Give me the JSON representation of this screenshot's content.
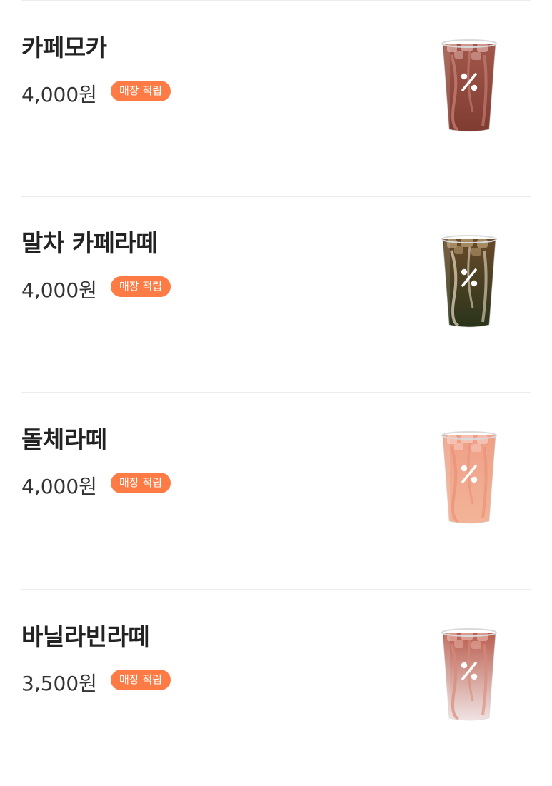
{
  "menu": {
    "items": [
      {
        "name": "카페모카",
        "price": "4,000원",
        "badge": "매장 적립",
        "drink": {
          "top": "#a3594b",
          "bottom": "#7e3a30",
          "ice": "#d8a6a0",
          "marble": "#c9847a"
        }
      },
      {
        "name": "말차 카페라떼",
        "price": "4,000원",
        "badge": "매장 적립",
        "drink": {
          "top": "#6a4a2a",
          "bottom": "#26331a",
          "ice": "#b59a6e",
          "marble": "#e9dcc6"
        }
      },
      {
        "name": "돌체라떼",
        "price": "4,000원",
        "badge": "매장 적립",
        "drink": {
          "top": "#ef9f86",
          "bottom": "#f2b598",
          "ice": "#f6c8bb",
          "marble": "#e99078"
        }
      },
      {
        "name": "바닐라빈라떼",
        "price": "3,500원",
        "badge": "매장 적립",
        "drink": {
          "top": "#b8594a",
          "bottom": "#f3ecec",
          "ice": "#e2a89c",
          "marble": "#d98a78"
        }
      }
    ]
  },
  "colors": {
    "badge": "#ff7b45",
    "divider": "#ededed",
    "name_text": "#222222",
    "price_text": "#333333"
  },
  "icons": {
    "cup_logo": "percent-logo-icon"
  }
}
